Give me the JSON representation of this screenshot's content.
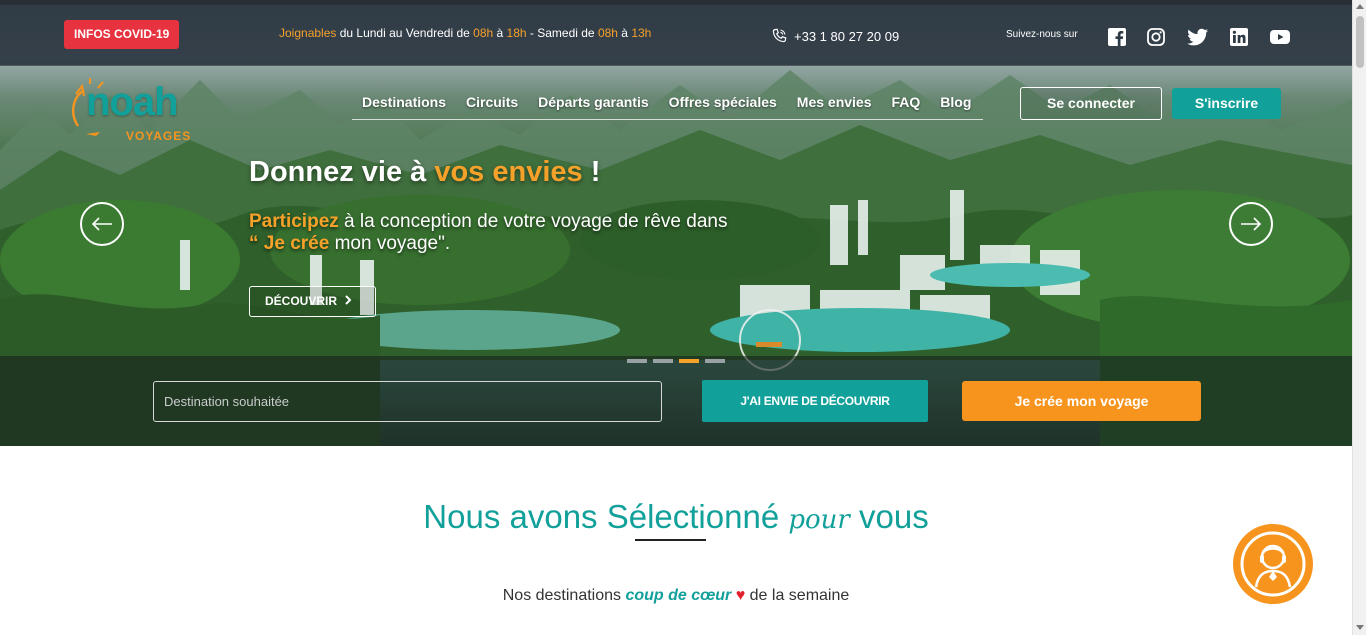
{
  "topbar": {
    "covid_label": "INFOS COVID-19",
    "hours": {
      "joignables": "Joignables",
      "days": " du Lundi au Vendredi de ",
      "start1": "08h",
      "a1": " à ",
      "end1": "18h",
      "saturday": " - Samedi de ",
      "start2": "08h",
      "a2": " à ",
      "end2": "13h"
    },
    "phone": "+33 1 80 27 20 09",
    "follow_label": "Suivez-nous sur",
    "social_icons": [
      "facebook-icon",
      "instagram-icon",
      "twitter-icon",
      "linkedin-icon",
      "youtube-icon"
    ]
  },
  "logo": {
    "brand": "noah",
    "sub": "VOYAGES"
  },
  "nav": {
    "items": [
      "Destinations",
      "Circuits",
      "Départs garantis",
      "Offres spéciales",
      "Mes envies",
      "FAQ",
      "Blog"
    ],
    "login": "Se connecter",
    "signup": "S'inscrire"
  },
  "slide": {
    "headline_pre": "Donnez vie à ",
    "headline_accent": "vos envies",
    "headline_post": " !",
    "sub_accent1": "Participez",
    "sub_mid": " à la conception de votre voyage de rêve dans",
    "sub_accent2": "“ Je crée",
    "sub_end": " mon voyage\".",
    "cta": "DÉCOUVRIR",
    "active_index": 2,
    "count": 4
  },
  "search": {
    "placeholder": "Destination souhaitée",
    "discover_button": "J'AI ENVIE DE DÉCOUVRIR",
    "create_button": "Je crée mon voyage"
  },
  "section": {
    "title_pre": "Nous avons Sélectionné ",
    "title_script": "pour",
    "title_post": " vous",
    "tagline_pre": "Nos destinations ",
    "tagline_accent": "coup de cœur",
    "tagline_heart": "♥",
    "tagline_post": " de la semaine"
  },
  "colors": {
    "teal": "#12a09a",
    "orange": "#f6941e",
    "red": "#e6333f"
  }
}
